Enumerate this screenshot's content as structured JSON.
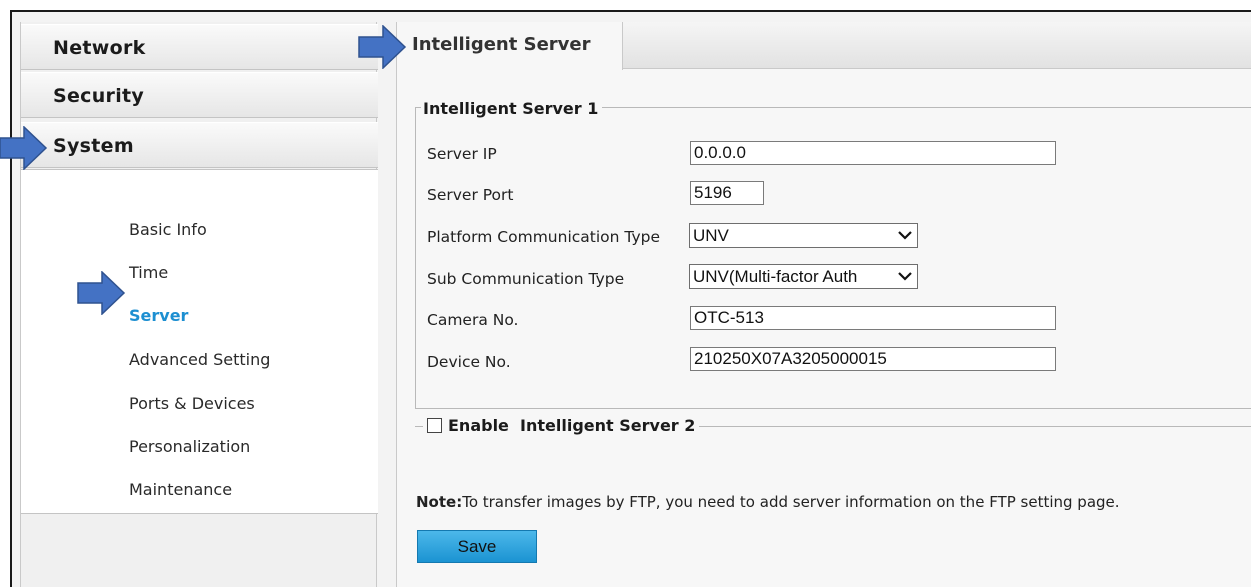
{
  "sidebar": {
    "headers": [
      "Network",
      "Security",
      "System"
    ],
    "items": [
      {
        "label": "Basic Info"
      },
      {
        "label": "Time"
      },
      {
        "label": "Server"
      },
      {
        "label": "Advanced Setting"
      },
      {
        "label": "Ports & Devices"
      },
      {
        "label": "Personalization"
      },
      {
        "label": "Maintenance"
      }
    ]
  },
  "tab": {
    "label": "Intelligent Server"
  },
  "server1": {
    "legend": "Intelligent Server 1",
    "fields": [
      {
        "label": "Server IP",
        "value": "0.0.0.0"
      },
      {
        "label": "Server Port",
        "value": "5196"
      },
      {
        "label": "Platform Communication Type",
        "value": "UNV"
      },
      {
        "label": "Sub Communication Type",
        "value": "UNV(Multi-factor Auth"
      },
      {
        "label": "Camera No.",
        "value": "OTC-513"
      },
      {
        "label": "Device No.",
        "value": "210250X07A3205000015"
      }
    ]
  },
  "server2": {
    "enable_label": "Enable  Intelligent Server 2",
    "checked": false
  },
  "note": {
    "prefix": "Note:",
    "text": "To transfer images by FTP, you need to add server information on the FTP setting page."
  },
  "save_label": "Save",
  "colors": {
    "accent": "#1d8fd1",
    "save_button": "#2aa3dc",
    "arrow_fill": "#4472c4",
    "arrow_stroke": "#2f528f"
  },
  "icons": {
    "annotation": "arrow-right-icon",
    "dropdown": "chevron-down-icon"
  }
}
